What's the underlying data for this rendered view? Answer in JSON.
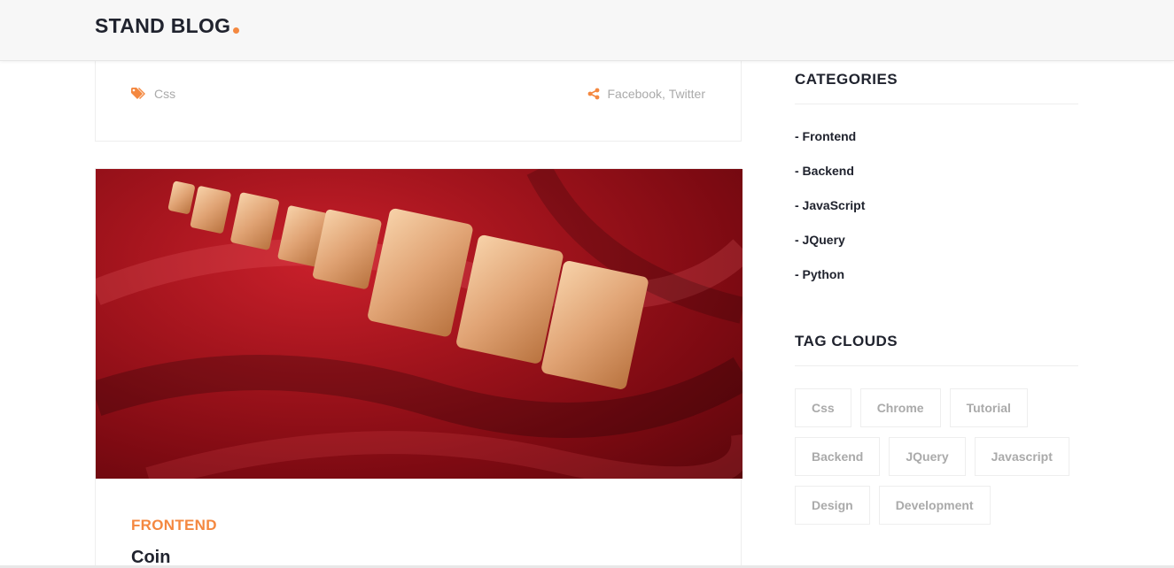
{
  "header": {
    "logo": "STAND BLOG"
  },
  "prev_post": {
    "tags": "Css",
    "share_links": [
      "Facebook",
      "Twitter"
    ],
    "share_separator": ","
  },
  "post": {
    "image_alt": "Gold bars on red silk",
    "category": "FRONTEND",
    "title": "Coin"
  },
  "sidebar": {
    "categories_heading": "CATEGORIES",
    "categories": [
      "- Frontend",
      "- Backend",
      "- JavaScript",
      "- JQuery",
      "- Python"
    ],
    "tags_heading": "TAG CLOUDS",
    "tags": [
      "Css",
      "Chrome",
      "Tutorial",
      "Backend",
      "JQuery",
      "Javascript",
      "Design",
      "Development"
    ]
  },
  "colors": {
    "accent": "#f48840",
    "dark": "#20232e",
    "muted": "#aaaaaa",
    "border": "#eeeeee"
  },
  "icons": {
    "tags": "tags-icon",
    "share": "share-icon"
  }
}
